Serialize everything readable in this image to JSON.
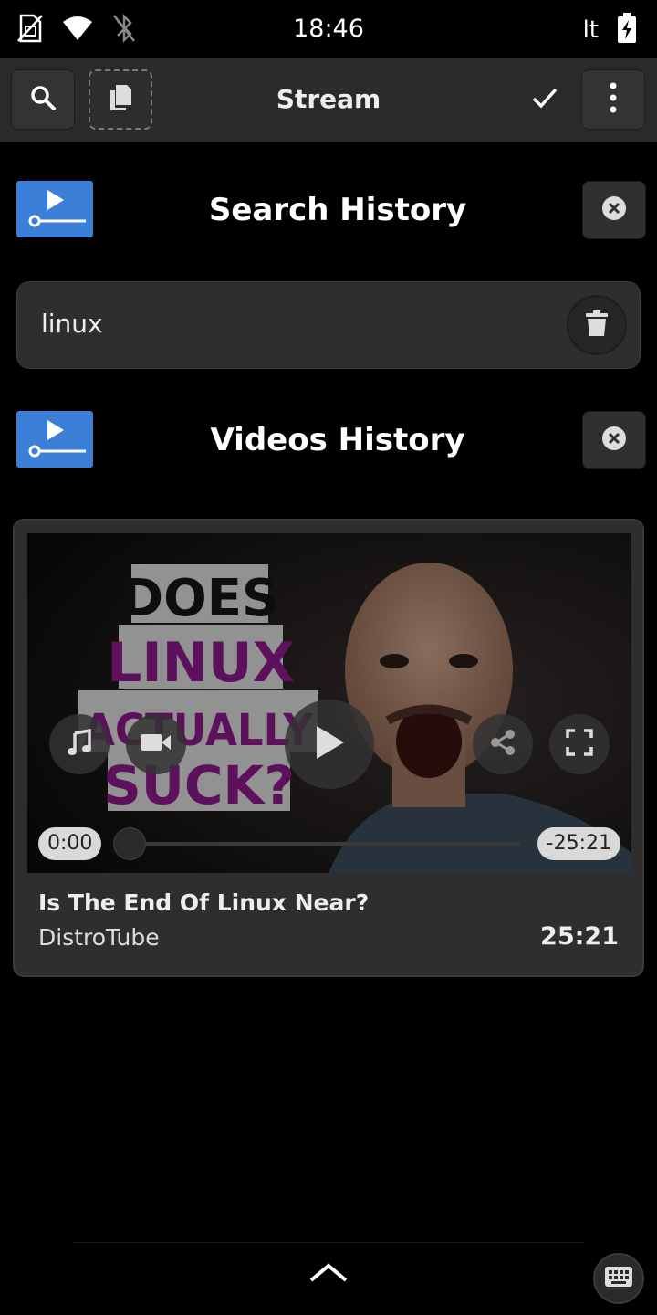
{
  "status_bar": {
    "time": "18:46",
    "keyboard_layout": "lt",
    "icons": [
      "no-sim-icon",
      "wifi-icon",
      "bluetooth-disabled-icon",
      "battery-charging-icon"
    ]
  },
  "header": {
    "title": "Stream",
    "icons": [
      "search-icon",
      "copy-icon",
      "check-icon",
      "more-vertical-icon"
    ]
  },
  "search_history": {
    "title": "Search History",
    "items": [
      {
        "query": "linux"
      }
    ]
  },
  "videos_history": {
    "title": "Videos History",
    "items": [
      {
        "title": "Is The End Of Linux Near?",
        "channel": "DistroTube",
        "duration": "25:21",
        "thumbnail_text": [
          "DOES",
          "LINUX",
          "ACTUALLY",
          "SUCK?"
        ],
        "player": {
          "current_time": "0:00",
          "remaining_time": "-25:21",
          "progress": 0
        }
      }
    ]
  },
  "colors": {
    "accent_blue": "#3b7fd8",
    "header_bg": "#2a2a2a",
    "card_bg": "#2e2e2e",
    "thumb_magenta": "#8a1a8a"
  }
}
